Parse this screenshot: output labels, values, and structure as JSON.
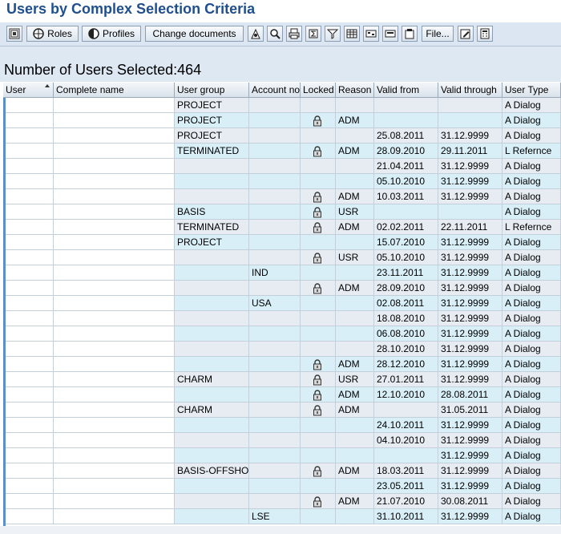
{
  "window": {
    "title": "Users by Complex Selection Criteria"
  },
  "toolbar": {
    "roles_label": "Roles",
    "profiles_label": "Profiles",
    "change_documents_label": "Change documents",
    "file_label": "File..."
  },
  "summary": {
    "count_text": "Number of Users Selected:464"
  },
  "table": {
    "columns": [
      "User",
      "Complete name",
      "User group",
      "Account no",
      "Locked",
      "Reason",
      "Valid from",
      "Valid through",
      "User Type"
    ],
    "rows": [
      {
        "user_group": "PROJECT",
        "account_no": "",
        "locked": false,
        "reason": "",
        "valid_from": "",
        "valid_through": "",
        "user_type": "A Dialog"
      },
      {
        "user_group": "PROJECT",
        "account_no": "",
        "locked": true,
        "reason": "ADM",
        "valid_from": "",
        "valid_through": "",
        "user_type": "A Dialog"
      },
      {
        "user_group": "PROJECT",
        "account_no": "",
        "locked": false,
        "reason": "",
        "valid_from": "25.08.2011",
        "valid_through": "31.12.9999",
        "user_type": "A Dialog"
      },
      {
        "user_group": "TERMINATED",
        "account_no": "",
        "locked": true,
        "reason": "ADM",
        "valid_from": "28.09.2010",
        "valid_through": "29.11.2011",
        "user_type": "L Refernce"
      },
      {
        "user_group": "",
        "account_no": "",
        "locked": false,
        "reason": "",
        "valid_from": "21.04.2011",
        "valid_through": "31.12.9999",
        "user_type": "A Dialog"
      },
      {
        "user_group": "",
        "account_no": "",
        "locked": false,
        "reason": "",
        "valid_from": "05.10.2010",
        "valid_through": "31.12.9999",
        "user_type": "A Dialog"
      },
      {
        "user_group": "",
        "account_no": "",
        "locked": true,
        "reason": "ADM",
        "valid_from": "10.03.2011",
        "valid_through": "31.12.9999",
        "user_type": "A Dialog"
      },
      {
        "user_group": "BASIS",
        "account_no": "",
        "locked": true,
        "reason": "USR",
        "valid_from": "",
        "valid_through": "",
        "user_type": "A Dialog"
      },
      {
        "user_group": "TERMINATED",
        "account_no": "",
        "locked": true,
        "reason": "ADM",
        "valid_from": "02.02.2011",
        "valid_through": "22.11.2011",
        "user_type": "L Refernce"
      },
      {
        "user_group": "PROJECT",
        "account_no": "",
        "locked": false,
        "reason": "",
        "valid_from": "15.07.2010",
        "valid_through": "31.12.9999",
        "user_type": "A Dialog"
      },
      {
        "user_group": "",
        "account_no": "",
        "locked": true,
        "reason": "USR",
        "valid_from": "05.10.2010",
        "valid_through": "31.12.9999",
        "user_type": "A Dialog"
      },
      {
        "user_group": "",
        "account_no": "IND",
        "locked": false,
        "reason": "",
        "valid_from": "23.11.2011",
        "valid_through": "31.12.9999",
        "user_type": "A Dialog"
      },
      {
        "user_group": "",
        "account_no": "",
        "locked": true,
        "reason": "ADM",
        "valid_from": "28.09.2010",
        "valid_through": "31.12.9999",
        "user_type": "A Dialog"
      },
      {
        "user_group": "",
        "account_no": "USA",
        "locked": false,
        "reason": "",
        "valid_from": "02.08.2011",
        "valid_through": "31.12.9999",
        "user_type": "A Dialog"
      },
      {
        "user_group": "",
        "account_no": "",
        "locked": false,
        "reason": "",
        "valid_from": "18.08.2010",
        "valid_through": "31.12.9999",
        "user_type": "A Dialog"
      },
      {
        "user_group": "",
        "account_no": "",
        "locked": false,
        "reason": "",
        "valid_from": "06.08.2010",
        "valid_through": "31.12.9999",
        "user_type": "A Dialog"
      },
      {
        "user_group": "",
        "account_no": "",
        "locked": false,
        "reason": "",
        "valid_from": "28.10.2010",
        "valid_through": "31.12.9999",
        "user_type": "A Dialog"
      },
      {
        "user_group": "",
        "account_no": "",
        "locked": true,
        "reason": "ADM",
        "valid_from": "28.12.2010",
        "valid_through": "31.12.9999",
        "user_type": "A Dialog"
      },
      {
        "user_group": "CHARM",
        "account_no": "",
        "locked": true,
        "reason": "USR",
        "valid_from": "27.01.2011",
        "valid_through": "31.12.9999",
        "user_type": "A Dialog"
      },
      {
        "user_group": "",
        "account_no": "",
        "locked": true,
        "reason": "ADM",
        "valid_from": "12.10.2010",
        "valid_through": "28.08.2011",
        "user_type": "A Dialog"
      },
      {
        "user_group": "CHARM",
        "account_no": "",
        "locked": true,
        "reason": "ADM",
        "valid_from": "",
        "valid_through": "31.05.2011",
        "user_type": "A Dialog"
      },
      {
        "user_group": "",
        "account_no": "",
        "locked": false,
        "reason": "",
        "valid_from": "24.10.2011",
        "valid_through": "31.12.9999",
        "user_type": "A Dialog"
      },
      {
        "user_group": "",
        "account_no": "",
        "locked": false,
        "reason": "",
        "valid_from": "04.10.2010",
        "valid_through": "31.12.9999",
        "user_type": "A Dialog"
      },
      {
        "user_group": "",
        "account_no": "",
        "locked": false,
        "reason": "",
        "valid_from": "",
        "valid_through": "31.12.9999",
        "user_type": "A Dialog"
      },
      {
        "user_group": "BASIS-OFFSHO",
        "account_no": "",
        "locked": true,
        "reason": "ADM",
        "valid_from": "18.03.2011",
        "valid_through": "31.12.9999",
        "user_type": "A Dialog"
      },
      {
        "user_group": "",
        "account_no": "",
        "locked": false,
        "reason": "",
        "valid_from": "23.05.2011",
        "valid_through": "31.12.9999",
        "user_type": "A Dialog"
      },
      {
        "user_group": "",
        "account_no": "",
        "locked": true,
        "reason": "ADM",
        "valid_from": "21.07.2010",
        "valid_through": "30.08.2011",
        "user_type": "A Dialog"
      },
      {
        "user_group": "",
        "account_no": "LSE",
        "locked": false,
        "reason": "",
        "valid_from": "31.10.2011",
        "valid_through": "31.12.9999",
        "user_type": "A Dialog"
      }
    ]
  },
  "icons": {
    "lock": "lock-icon",
    "sort": "sort-ascending-icon"
  },
  "colors": {
    "title": "#1f4f8f",
    "row_a": "#e6ecf2",
    "row_b": "#d9eff8",
    "selection": "#5b8fc7"
  }
}
